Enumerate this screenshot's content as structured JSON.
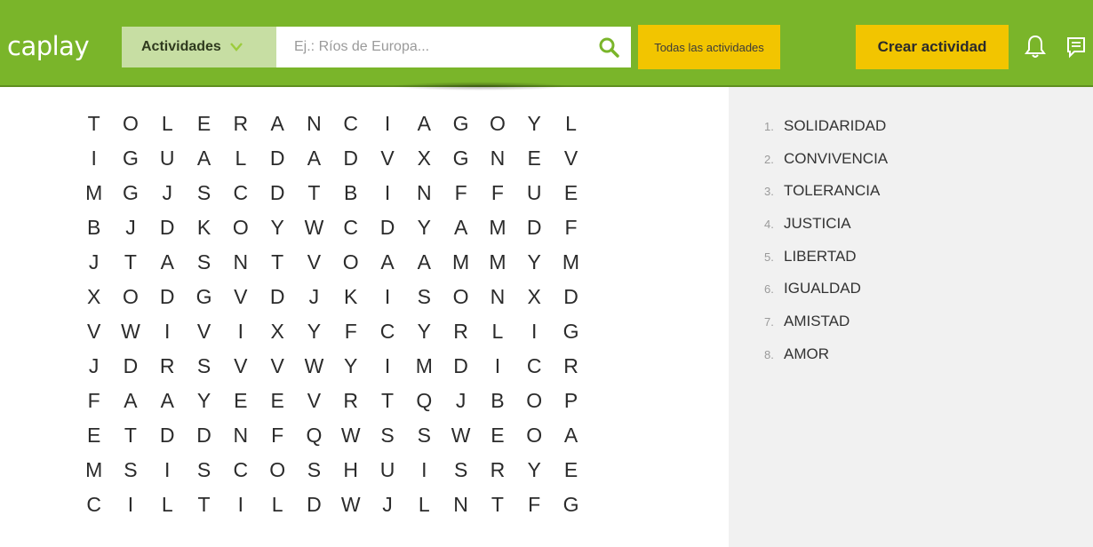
{
  "header": {
    "logo": "caplay",
    "category": "Actividades",
    "search_placeholder": "Ej.: Ríos de Europa...",
    "all_activities": "Todas las actividades",
    "create_activity": "Crear actividad"
  },
  "colors": {
    "topbar": "#7ab52a",
    "category_bg": "#c7dea3",
    "accent_yellow": "#f2c500",
    "panel_bg": "#f1f1f1"
  },
  "icons": [
    "chevron-down-icon",
    "search-icon",
    "bell-icon",
    "chat-icon"
  ],
  "grid": [
    [
      "T",
      "O",
      "L",
      "E",
      "R",
      "A",
      "N",
      "C",
      "I",
      "A",
      "G",
      "O",
      "Y",
      "L"
    ],
    [
      "I",
      "G",
      "U",
      "A",
      "L",
      "D",
      "A",
      "D",
      "V",
      "X",
      "G",
      "N",
      "E",
      "V"
    ],
    [
      "M",
      "G",
      "J",
      "S",
      "C",
      "D",
      "T",
      "B",
      "I",
      "N",
      "F",
      "F",
      "U",
      "E"
    ],
    [
      "B",
      "J",
      "D",
      "K",
      "O",
      "Y",
      "W",
      "C",
      "D",
      "Y",
      "A",
      "M",
      "D",
      "F"
    ],
    [
      "J",
      "T",
      "A",
      "S",
      "N",
      "T",
      "V",
      "O",
      "A",
      "A",
      "M",
      "M",
      "Y",
      "M"
    ],
    [
      "X",
      "O",
      "D",
      "G",
      "V",
      "D",
      "J",
      "K",
      "I",
      "S",
      "O",
      "N",
      "X",
      "D"
    ],
    [
      "V",
      "W",
      "I",
      "V",
      "I",
      "X",
      "Y",
      "F",
      "C",
      "Y",
      "R",
      "L",
      "I",
      "G"
    ],
    [
      "J",
      "D",
      "R",
      "S",
      "V",
      "V",
      "W",
      "Y",
      "I",
      "M",
      "D",
      "I",
      "C",
      "R"
    ],
    [
      "F",
      "A",
      "A",
      "Y",
      "E",
      "E",
      "V",
      "R",
      "T",
      "Q",
      "J",
      "B",
      "O",
      "P"
    ],
    [
      "E",
      "T",
      "D",
      "D",
      "N",
      "F",
      "Q",
      "W",
      "S",
      "S",
      "W",
      "E",
      "O",
      "A"
    ],
    [
      "M",
      "S",
      "I",
      "S",
      "C",
      "O",
      "S",
      "H",
      "U",
      "I",
      "S",
      "R",
      "Y",
      "E"
    ],
    [
      "C",
      "I",
      "L",
      "T",
      "I",
      "L",
      "D",
      "W",
      "J",
      "L",
      "N",
      "T",
      "F",
      "G"
    ]
  ],
  "words": [
    {
      "num": "1.",
      "word": "SOLIDARIDAD"
    },
    {
      "num": "2.",
      "word": "CONVIVENCIA"
    },
    {
      "num": "3.",
      "word": "TOLERANCIA"
    },
    {
      "num": "4.",
      "word": "JUSTICIA"
    },
    {
      "num": "5.",
      "word": "LIBERTAD"
    },
    {
      "num": "6.",
      "word": "IGUALDAD"
    },
    {
      "num": "7.",
      "word": "AMISTAD"
    },
    {
      "num": "8.",
      "word": "AMOR"
    }
  ]
}
